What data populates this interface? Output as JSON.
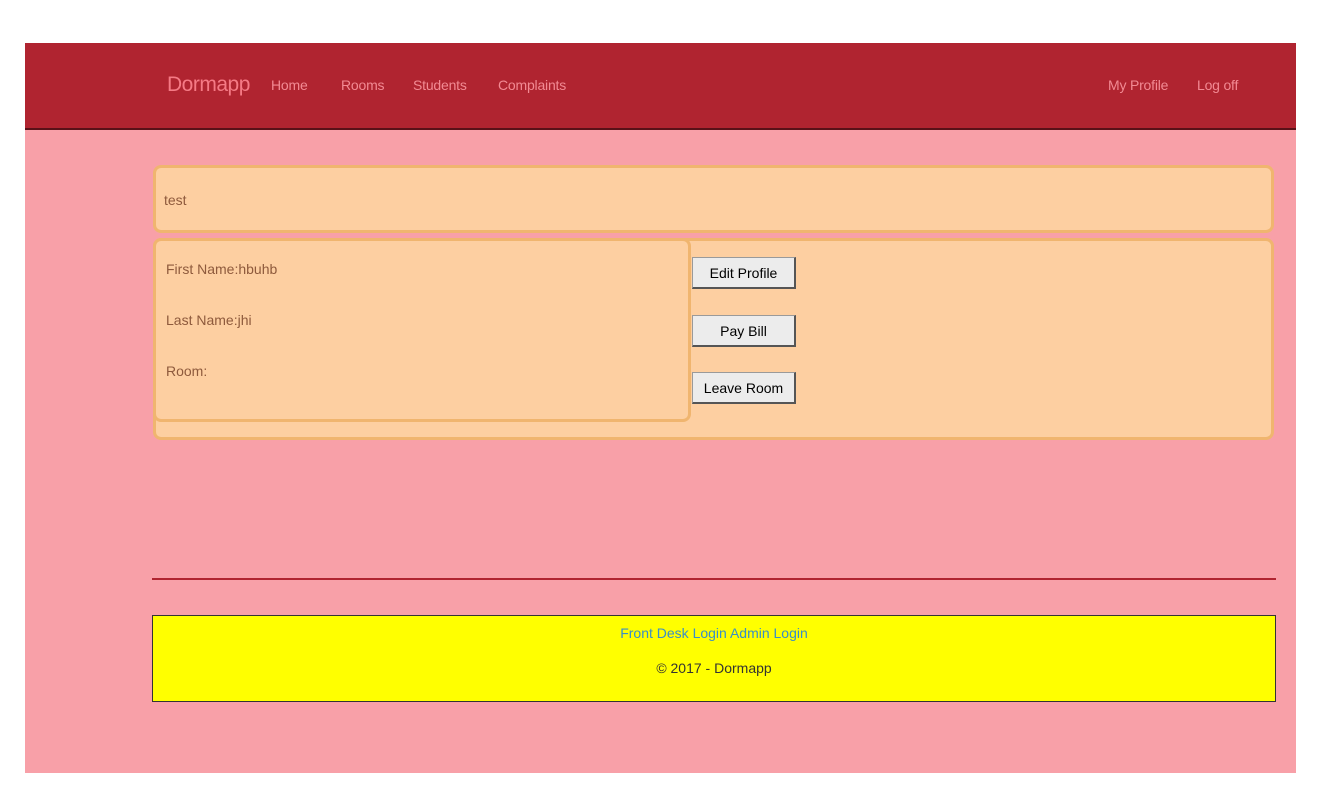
{
  "navbar": {
    "brand": "Dormapp",
    "links": [
      "Home",
      "Rooms",
      "Students",
      "Complaints"
    ],
    "right_links": [
      "My Profile",
      "Log off"
    ]
  },
  "page_title": "test",
  "profile": {
    "first_name": "First Name:hbuhb",
    "last_name": "Last Name:jhi",
    "room": "Room:"
  },
  "buttons": {
    "edit_profile": "Edit Profile",
    "pay_bill": "Pay Bill",
    "leave_room": "Leave Room"
  },
  "footer": {
    "front_desk_login": "Front Desk Login",
    "admin_login": "Admin Login",
    "copyright": "© 2017 - Dormapp"
  },
  "colors": {
    "navbar_bg": "#b02430",
    "page_bg": "#f8a0a8",
    "panel_bg": "#fdcfa1",
    "footer_bg": "#ffff00"
  }
}
